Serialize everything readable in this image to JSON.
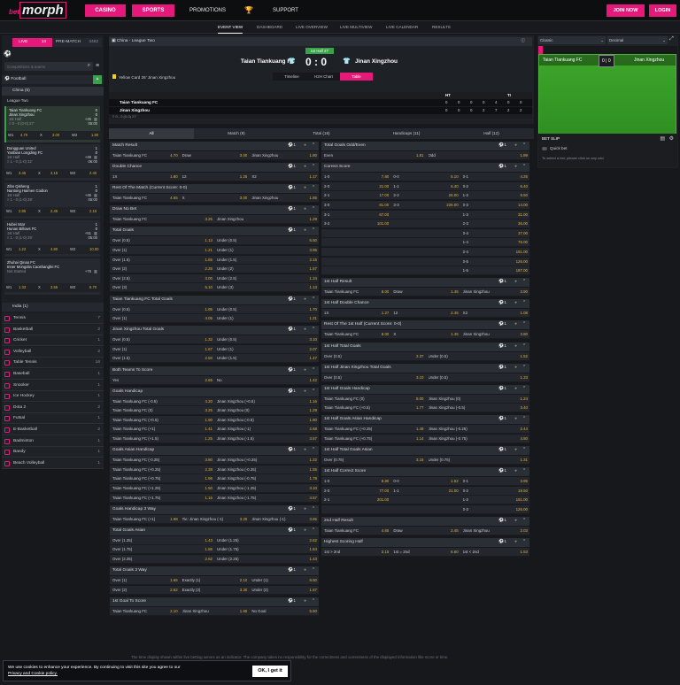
{
  "header": {
    "logo_pre": "bet",
    "logo_main": "morph",
    "casino": "CASINO",
    "sports": "SPORTS",
    "promotions": "PROMOTIONS",
    "support": "SUPPORT",
    "join": "JOIN NOW",
    "login": "LOGIN"
  },
  "subnav": [
    "EVENT VIEW",
    "DASHBOARD",
    "LIVE OVERVIEW",
    "LIVE MULTIVIEW",
    "LIVE CALENDAR",
    "RESULTS"
  ],
  "left": {
    "tab_live": "LIVE",
    "tab_live_count": "14",
    "tab_prematch": "PRE-MATCH",
    "tab_pm_count": "3462",
    "search_placeholder": "Competitions & teams",
    "football": "Football",
    "football_count": "5",
    "china": "China (5)",
    "league_two": "League Two",
    "matches": [
      {
        "home": "Taian Tiankuang FC",
        "away": "Jinan Xingzhou",
        "hs": "0",
        "as": "0",
        "period": "1st Half",
        "minute": "≡ 0 - 0 (0-0) 27'",
        "plus": "+45",
        "time": "05:00",
        "w1": "4.70",
        "x": "3.00",
        "w2": "1.80"
      },
      {
        "home": "Dongguan United",
        "away": "Yanbian Longding FC",
        "hs": "1",
        "as": "0",
        "period": "1st Half",
        "minute": "≡ 1 - 0 (1-0) 32'",
        "plus": "+49",
        "time": "06:00",
        "w1": "3.45",
        "x": "3.15",
        "w2": "2.40"
      },
      {
        "home": "Zibo Qisheng",
        "away": "Nantong Haimen Codion",
        "hs": "1",
        "as": "0",
        "period": "1st Half",
        "minute": "≡ 1 - 0 (1-0) 29'",
        "plus": "+45",
        "time": "05:00",
        "w1": "2.85",
        "x": "2.45",
        "w2": "2.15"
      },
      {
        "home": "Hubei Istar",
        "away": "Hunan Billows FC",
        "hs": "1",
        "as": "0",
        "period": "1st Half",
        "minute": "≡ 1 - 0 (1-0) 29'",
        "plus": "+51",
        "time": "05:00",
        "w1": "1.22",
        "x": "4.80",
        "w2": "10.00"
      },
      {
        "home": "Zhuhai Qinao FC",
        "away": "Inner Mongolia Caoshangfei FC",
        "hs": "",
        "as": "",
        "period": "Not Started",
        "minute": "",
        "plus": "+76",
        "time": "",
        "w1": "1.33",
        "x": "3.55",
        "w2": "6.70"
      }
    ],
    "india": "India (1)",
    "sports": [
      {
        "n": "Tennis",
        "c": "7"
      },
      {
        "n": "Basketball",
        "c": "2"
      },
      {
        "n": "Cricket",
        "c": "1"
      },
      {
        "n": "Volleyball",
        "c": "2"
      },
      {
        "n": "Table Tennis",
        "c": "16"
      },
      {
        "n": "Baseball",
        "c": "1"
      },
      {
        "n": "Snooker",
        "c": "1"
      },
      {
        "n": "Ice Hockey",
        "c": "1"
      },
      {
        "n": "Dota 2",
        "c": "2"
      },
      {
        "n": "Futsal",
        "c": "1"
      },
      {
        "n": "E-Basketball",
        "c": "2"
      },
      {
        "n": "Badminton",
        "c": "1"
      },
      {
        "n": "Bandy",
        "c": "1"
      },
      {
        "n": "Beach Volleyball",
        "c": "1"
      }
    ]
  },
  "event": {
    "league": "China - League Two",
    "period": "1st Half 27'",
    "home": "Taian Tiankuang FC",
    "away": "Jinan Xingzhou",
    "hs": "0",
    "sep": ":",
    "as": "0",
    "yellow": "Yellow Card 26' Jinan Xingzhou",
    "tabs": [
      "Timeline",
      "H2H Chart",
      "Table"
    ],
    "stats_head": [
      "HT",
      "",
      "",
      "",
      "",
      "TI",
      ""
    ],
    "stats": [
      {
        "team": "Taian Tiankuang FC",
        "v": [
          "0",
          "0",
          "0",
          "0",
          "4",
          "0",
          "0"
        ]
      },
      {
        "team": "Jinan Xingzhou",
        "v": [
          "0",
          "0",
          "0",
          "2",
          "7",
          "2",
          "2"
        ]
      }
    ],
    "stat_foot": "≡ 0 - 0 (0-0) 27'",
    "filters": [
      "All",
      "Match (9)",
      "Total (16)",
      "Handicaps (11)",
      "Half (12)"
    ]
  },
  "markets_left": [
    {
      "t": "Match Result",
      "rows": [
        [
          "Taian Tiankuang FC",
          "4.70",
          "Draw",
          "3.00",
          "Jinan Xingzhou",
          "1.80"
        ]
      ]
    },
    {
      "t": "Double Chance",
      "rows": [
        [
          "1X",
          "1.80",
          "12",
          "1.25",
          "X2",
          "1.17"
        ]
      ]
    },
    {
      "t": "Rest Of The Match (Current Score: 0-0)",
      "rows": [
        [
          "Taian Tiankuang FC",
          "4.65",
          "X",
          "3.00",
          "Jinan Xingzhou",
          "1.85"
        ]
      ]
    },
    {
      "t": "Draw No Bet",
      "rows": [
        [
          "Taian Tiankuang FC",
          "3.25",
          "Jinan Xingzhou",
          "1.29"
        ]
      ]
    },
    {
      "t": "Total Goals",
      "rows": [
        [
          "Over (0.5)",
          "1.13",
          "Under (0.5)",
          "5.50"
        ],
        [
          "Over (1)",
          "1.21",
          "Under (1)",
          "3.96"
        ],
        [
          "Over (1.5)",
          "1.65",
          "Under (1.5)",
          "2.15"
        ],
        [
          "Over (2)",
          "2.25",
          "Under (2)",
          "1.57"
        ],
        [
          "Over (2.5)",
          "3.00",
          "Under (2.5)",
          "1.34"
        ],
        [
          "Over (3)",
          "5.10",
          "Under (3)",
          "1.13"
        ]
      ]
    },
    {
      "t": "Taian Tiankuang FC Total Goals",
      "rows": [
        [
          "Over (0.5)",
          "1.95",
          "Under (0.5)",
          "1.70"
        ],
        [
          "Over (1)",
          "4.05",
          "Under (1)",
          "1.21"
        ]
      ]
    },
    {
      "t": "Jinan Xingzhou Total Goals",
      "rows": [
        [
          "Over (0.5)",
          "1.32",
          "Under (0.5)",
          "3.10"
        ],
        [
          "Over (1)",
          "1.67",
          "Under (1)",
          "2.07"
        ],
        [
          "Over (1.5)",
          "2.50",
          "Under (1.5)",
          "1.47"
        ]
      ]
    },
    {
      "t": "Both Teams To Score",
      "rows": [
        [
          "Yes",
          "2.65",
          "No",
          "1.42"
        ]
      ]
    },
    {
      "t": "Goals Handicap",
      "rows": [
        [
          "Taian Tiankuang FC (-0.5)",
          "4.20",
          "Jinan Xingzhou (+0.5)",
          "1.16"
        ],
        [
          "Taian Tiankuang FC (0)",
          "3.25",
          "Jinan Xingzhou (0)",
          "1.29"
        ],
        [
          "Taian Tiankuang FC (+0.5)",
          "1.90",
          "Jinan Xingzhou (-0.5)",
          "1.80"
        ],
        [
          "Taian Tiankuang FC (+1)",
          "1.41",
          "Jinan Xingzhou (-1)",
          "2.68"
        ],
        [
          "Taian Tiankuang FC (+1.5)",
          "1.25",
          "Jinan Xingzhou (-1.5)",
          "3.57"
        ]
      ]
    },
    {
      "t": "Goals Asian Handicap",
      "rows": [
        [
          "Taian Tiankuang FC (-0.25)",
          "3.80",
          "Jinan Xingzhou (+0.25)",
          "1.22"
        ],
        [
          "Taian Tiankuang FC (+0.25)",
          "2.38",
          "Jinan Xingzhou (-0.25)",
          "1.55"
        ],
        [
          "Taian Tiankuang FC (+0.75)",
          "1.96",
          "Jinan Xingzhou (-0.75)",
          "1.78"
        ],
        [
          "Taian Tiankuang FC (+1.25)",
          "1.50",
          "Jinan Xingzhou (-1.25)",
          "3.10"
        ],
        [
          "Taian Tiankuang FC (+1.75)",
          "1.16",
          "Jinan Xingzhou (-1.75)",
          "4.57"
        ]
      ]
    },
    {
      "t": "Goals Handicap 3 Way",
      "rows": [
        [
          "Taian Tiankuang FC (+1)",
          "1.98",
          "Tie: Jinan Xingzhou (-1)",
          "3.25",
          "Jinan Xingzhou (-1)",
          "3.65"
        ]
      ]
    },
    {
      "t": "Total Goals Asian",
      "rows": [
        [
          "Over (1.25)",
          "1.43",
          "Under (1.25)",
          "2.62"
        ],
        [
          "Over (1.75)",
          "1.86",
          "Under (1.75)",
          "1.84"
        ],
        [
          "Over (2.25)",
          "2.62",
          "Under (2.25)",
          "1.43"
        ]
      ]
    },
    {
      "t": "Total Goals 3 Way",
      "rows": [
        [
          "Over (1)",
          "1.65",
          "Exactly (1)",
          "2.10",
          "Under (1)",
          "8.50"
        ],
        [
          "Over (2)",
          "2.62",
          "Exactly (2)",
          "3.30",
          "Under (2)",
          "1.67"
        ]
      ]
    },
    {
      "t": "1st Goal To Score",
      "rows": [
        [
          "Taian Tiankuang FC",
          "2.10",
          "Jinan Xingzhou",
          "1.65",
          "No Goal",
          "5.50"
        ]
      ]
    }
  ],
  "markets_right": [
    {
      "t": "Total Goals Odd/Even",
      "rows": [
        [
          "Even",
          "1.81",
          "Odd",
          "1.89"
        ]
      ]
    },
    {
      "t": "Correct Score",
      "rows": [
        [
          "1-0",
          "7.80",
          "0-0",
          "5.10",
          "0-1",
          "4.25"
        ],
        [
          "2-0",
          "21.00",
          "1-1",
          "6.40",
          "0-2",
          "6.40"
        ],
        [
          "2-1",
          "17.00",
          "2-2",
          "26.00",
          "1-2",
          "9.50"
        ],
        [
          "3-0",
          "81.00",
          "3-3",
          "226.00",
          "0-3",
          "14.00"
        ],
        [
          "3-1",
          "67.00",
          "",
          "",
          "1-3",
          "31.00"
        ],
        [
          "3-2",
          "101.00",
          "",
          "",
          "2-3",
          "36.00"
        ],
        [
          "",
          "",
          "",
          "",
          "0-4",
          "37.00"
        ],
        [
          "",
          "",
          "",
          "",
          "1-4",
          "76.00"
        ],
        [
          "",
          "",
          "",
          "",
          "2-4",
          "151.00"
        ],
        [
          "",
          "",
          "",
          "",
          "0-5",
          "126.00"
        ],
        [
          "",
          "",
          "",
          "",
          "1-5",
          "187.00"
        ]
      ]
    },
    {
      "t": "1st Half Result",
      "rows": [
        [
          "Taian Tiankuang FC",
          "8.00",
          "Draw",
          "1.45",
          "Jinan Xingzhou",
          "3.90"
        ]
      ]
    },
    {
      "t": "1st Half Double Chance",
      "rows": [
        [
          "1X",
          "1.27",
          "12",
          "2.45",
          "X2",
          "1.08"
        ]
      ]
    },
    {
      "t": "Rest Of The 1st Half (Current Score: 0-0)",
      "rows": [
        [
          "Taian Tiankuang FC",
          "8.00",
          "X",
          "1.45",
          "Jinan Xingzhou",
          "3.80"
        ]
      ]
    },
    {
      "t": "1st Half Total Goals",
      "rows": [
        [
          "Over (0.5)",
          "2.37",
          "Under (0.5)",
          "1.52"
        ]
      ]
    },
    {
      "t": "1st Half Jinan Xingzhou Total Goals",
      "rows": [
        [
          "Over (0.5)",
          "3.10",
          "Under (0.5)",
          "1.33"
        ]
      ]
    },
    {
      "t": "1st Half Goals Handicap",
      "rows": [
        [
          "Taian Tiankuang FC (0)",
          "8.00",
          "Jinan Xingzhou (0)",
          "1.24"
        ],
        [
          "Taian Tiankuang FC (+0.5)",
          "1.77",
          "Jinan Xingzhou (-0.5)",
          "3.40"
        ]
      ]
    },
    {
      "t": "1st Half Goals Asian Handicap",
      "rows": [
        [
          "Taian Tiankuang FC (+0.25)",
          "1.49",
          "Jinan Xingzhou (-0.25)",
          "2.44"
        ],
        [
          "Taian Tiankuang FC (+0.75)",
          "1.14",
          "Jinan Xingzhou (-0.75)",
          "4.50"
        ]
      ]
    },
    {
      "t": "1st Half Total Goals Asian",
      "rows": [
        [
          "Over (0.75)",
          "3.15",
          "Under (0.75)",
          "1.31"
        ]
      ]
    },
    {
      "t": "1st Half Correct Score",
      "rows": [
        [
          "1-0",
          "8.80",
          "0-0",
          "1.52",
          "0-1",
          "3.95"
        ],
        [
          "2-0",
          "77.00",
          "1-1",
          "21.00",
          "0-2",
          "19.50"
        ],
        [
          "2-1",
          "201.00",
          "",
          "",
          "1-2",
          "151.00"
        ],
        [
          "",
          "",
          "",
          "",
          "0-3",
          "126.00"
        ]
      ]
    },
    {
      "t": "2nd Half Result",
      "rows": [
        [
          "Taian Tiankuang FC",
          "4.65",
          "Draw",
          "2.45",
          "Jinan Xingzhou",
          "2.03"
        ]
      ]
    },
    {
      "t": "Highest Scoring Half",
      "rows": [
        [
          "1st > 2nd",
          "3.15",
          "1st = 2nd",
          "6.60",
          "1st < 2nd",
          "1.53"
        ]
      ]
    }
  ],
  "rightpanel": {
    "view1": "Classic",
    "view2": "Decimal",
    "home": "Taian Tiankuang FC",
    "hs": "0",
    "as": "0",
    "away": "Jinan Xingzhou",
    "betslip": "BET SLIP",
    "quickbet": "Quick bet",
    "hint": "To select a bet, please click on any odd"
  },
  "footer_note": "The time display shown within live betting serves as an indicator. The company takes no responsibility for the correctness and currentness of the displayed information like score or time.",
  "cookie": {
    "line1": "We use cookies to enhance your experience. By continuing to visit this site you agree to our",
    "link": "Privacy and Cookie policy.",
    "ok": "OK, I get it"
  },
  "colors": {
    "accent": "#e6197a",
    "odds": "#e2b13c",
    "pitch": "#3ea62b"
  }
}
